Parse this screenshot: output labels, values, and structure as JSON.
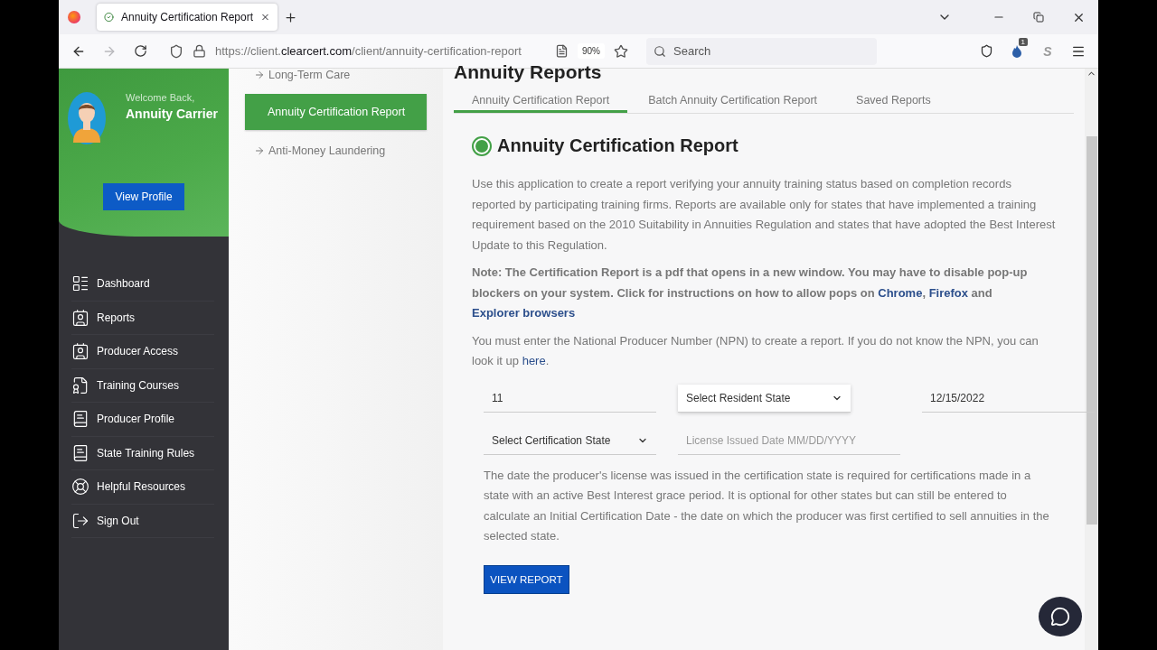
{
  "browser": {
    "tab": {
      "title": "Annuity Certification Report",
      "selected": true
    },
    "url": {
      "scheme": "https://client.",
      "domain": "clearcert.com",
      "path": "/client/annuity-certification-report"
    },
    "zoom": "90%",
    "search": {
      "placeholder": "Search"
    },
    "extension_badge": "1",
    "extension_letter": "S",
    "forward_disabled": true
  },
  "sidebar": {
    "welcome": "Welcome Back,",
    "user": "Annuity Carrier",
    "profile_button": "View Profile",
    "items": [
      {
        "label": "Dashboard"
      },
      {
        "label": "Reports"
      },
      {
        "label": "Producer Access"
      },
      {
        "label": "Training Courses"
      },
      {
        "label": "Producer Profile"
      },
      {
        "label": "State Training Rules"
      },
      {
        "label": "Helpful Resources"
      },
      {
        "label": "Sign Out"
      }
    ]
  },
  "submenu": [
    {
      "label": "Long-Term Care",
      "selected": false
    },
    {
      "label": "Annuity Certification Report",
      "selected": true
    },
    {
      "label": "Anti-Money Laundering",
      "selected": false
    }
  ],
  "main": {
    "heading": "Annuity Reports",
    "tabs": [
      {
        "label": "Annuity Certification Report",
        "selected": true
      },
      {
        "label": "Batch Annuity Certification Report",
        "selected": false
      },
      {
        "label": "Saved Reports",
        "selected": false
      }
    ],
    "title": "Annuity Certification Report",
    "intro": "Use this application to create a report verifying your annuity training status based on completion records reported by participating training firms. Reports are available only for states that have implemented a training requirement based on the 2010 Suitability in Annuities Regulation and states that have adopted the Best Interest Update to this Regulation.",
    "note": [
      {
        "kind": "text",
        "text": "Note: The Certification Report is a pdf that opens in a new window. You may have to disable pop-up blockers on your system. Click for instructions on how to allow pops on "
      },
      {
        "kind": "link",
        "text": "Chrome"
      },
      {
        "kind": "text",
        "text": ", "
      },
      {
        "kind": "link",
        "text": "Firefox"
      },
      {
        "kind": "text",
        "text": " and "
      },
      {
        "kind": "link",
        "text": "Explorer browsers"
      }
    ],
    "npn_note": [
      {
        "kind": "text",
        "text": "You must enter the National Producer Number (NPN) to create a report. If you do not know the NPN, you can look it up "
      },
      {
        "kind": "link",
        "text": "here"
      },
      {
        "kind": "text",
        "text": "."
      }
    ],
    "fields": [
      {
        "kind": "input",
        "value": "11"
      },
      {
        "kind": "select",
        "value": "Select Resident State",
        "focused": true
      },
      {
        "kind": "input",
        "value": "12/15/2022"
      },
      {
        "kind": "select",
        "value": "Select Certification State",
        "focused": false
      },
      {
        "kind": "input",
        "placeholder": "License Issued Date MM/DD/YYYY"
      }
    ],
    "license_note": "The date the producer's license was issued in the certification state is required for certifications made in a state with an active Best Interest grace period. It is optional for other states but can still be entered to calculate an Initial Certification Date - the date on which the producer was first certified to sell annuities in the selected state.",
    "button": "VIEW REPORT"
  }
}
